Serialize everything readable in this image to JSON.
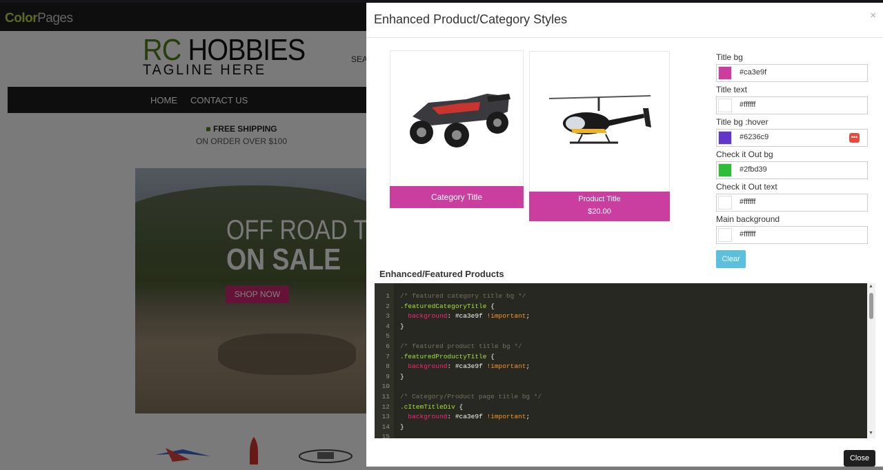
{
  "background_page": {
    "brand": {
      "part1": "Color",
      "part2": "Pages"
    },
    "store_logo": {
      "rc": "RC",
      "hobbies": " HOBBIES",
      "tagline": "TAGLINE HERE"
    },
    "search_label": "SEA",
    "nav": {
      "items": [
        "HOME",
        "CONTACT US"
      ]
    },
    "shipping": {
      "title": "FREE SHIPPING",
      "subtitle": "ON ORDER OVER $100"
    },
    "hero": {
      "line1": "OFF ROAD TRU",
      "line2": "ON SALE",
      "button": "SHOP NOW"
    }
  },
  "modal": {
    "title": "Enhanced Product/Category Styles",
    "close_x": "×",
    "category_card": {
      "title": "Category Title",
      "image_icon": "rc-truck-image"
    },
    "product_card": {
      "title": "Product Title",
      "price": "$20.00",
      "image_icon": "rc-helicopter-image"
    },
    "fields": [
      {
        "label": "Title bg",
        "value": "#ca3e9f",
        "color": "#ca3e9f"
      },
      {
        "label": "Title text",
        "value": "#ffffff",
        "color": "#ffffff"
      },
      {
        "label": "Title bg :hover",
        "value": "#6236c9",
        "color": "#6236c9",
        "picker_icon": "color-picker-icon",
        "picker_label": "•••"
      },
      {
        "label": "Check it Out bg",
        "value": "#2fbd39",
        "color": "#2fbd39"
      },
      {
        "label": "Check it Out text",
        "value": "#ffffff",
        "color": "#ffffff"
      },
      {
        "label": "Main background",
        "value": "#ffffff",
        "color": "#ffffff"
      }
    ],
    "clear_button": "Clear",
    "section_title": "Enhanced/Featured Products",
    "code": {
      "line_numbers": [
        "1",
        "2",
        "3",
        "4",
        "5",
        "6",
        "7",
        "8",
        "9",
        "10",
        "11",
        "12",
        "13",
        "14",
        "15"
      ],
      "lines": [
        {
          "comment": "/* featured category title bg */"
        },
        {
          "selector": ".featuredCategoryTitle",
          "rest": " {"
        },
        {
          "prop": "  background",
          "value": ": #ca3e9f ",
          "imp": "!important",
          "end": ";"
        },
        {
          "plain": "}"
        },
        {
          "plain": ""
        },
        {
          "comment": "/* featured product title bg */"
        },
        {
          "selector": ".featuredProductyTitle",
          "rest": " {"
        },
        {
          "prop": "  background",
          "value": ": #ca3e9f ",
          "imp": "!important",
          "end": ";"
        },
        {
          "plain": "}"
        },
        {
          "plain": ""
        },
        {
          "comment": "/* Category/Product page title bg */"
        },
        {
          "selector": ".cItemTitleDiv",
          "rest": " {"
        },
        {
          "prop": "  background",
          "value": ": #ca3e9f ",
          "imp": "!important",
          "end": ";"
        },
        {
          "plain": "}"
        },
        {
          "plain": ""
        }
      ]
    },
    "close_button": "Close"
  }
}
